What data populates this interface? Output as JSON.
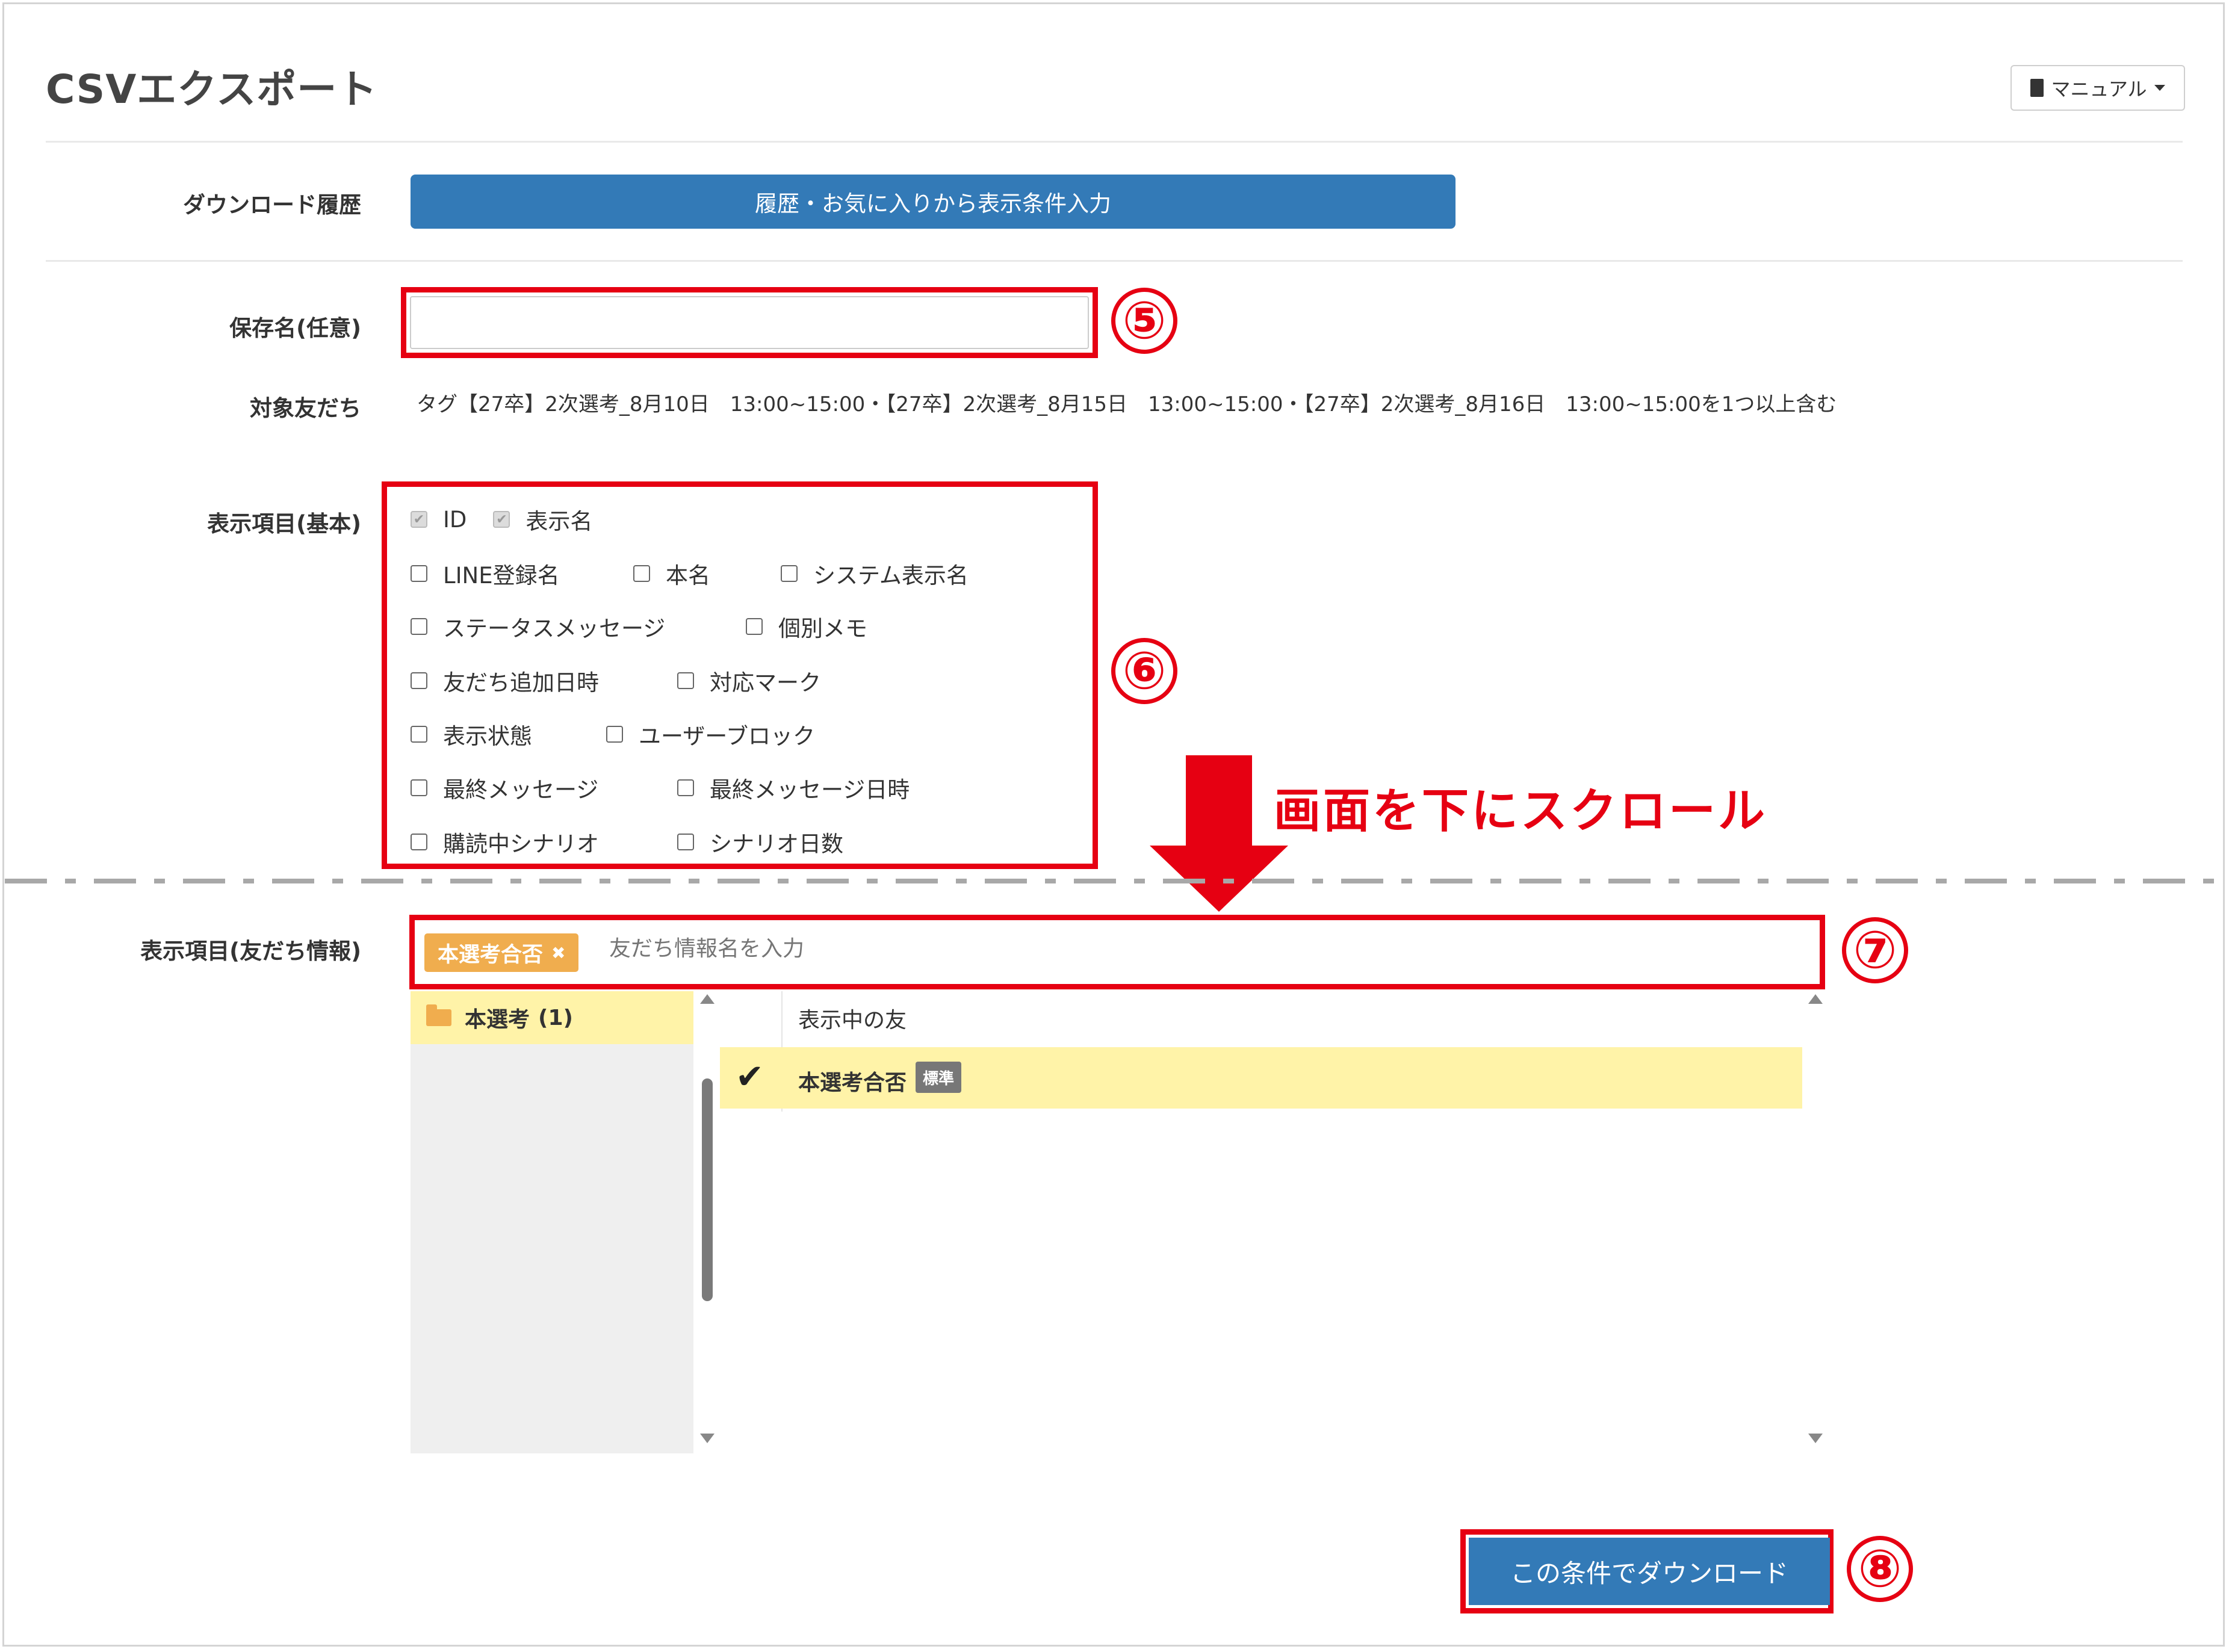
{
  "header": {
    "title": "CSVエクスポート",
    "manual_button": {
      "label": "マニュアル",
      "icon": "book-icon"
    }
  },
  "download_history": {
    "label": "ダウンロード履歴",
    "button_label": "履歴・お気に入りから表示条件入力"
  },
  "save_name": {
    "label": "保存名(任意)",
    "value": "",
    "placeholder": ""
  },
  "target_friends": {
    "label": "対象友だち",
    "text": "タグ【27卒】2次選考_8月10日　13:00~15:00・【27卒】2次選考_8月15日　13:00~15:00・【27卒】2次選考_8月16日　13:00~15:00を1つ以上含む"
  },
  "display_basic": {
    "label": "表示項目(基本)",
    "rows": [
      [
        {
          "label": "ID",
          "checked": true,
          "disabled": true
        },
        {
          "label": "表示名",
          "checked": true,
          "disabled": true
        }
      ],
      [
        {
          "label": "LINE登録名",
          "checked": false
        },
        {
          "label": "本名",
          "checked": false
        },
        {
          "label": "システム表示名",
          "checked": false
        }
      ],
      [
        {
          "label": "ステータスメッセージ",
          "checked": false
        },
        {
          "label": "個別メモ",
          "checked": false
        }
      ],
      [
        {
          "label": "友だち追加日時",
          "checked": false
        },
        {
          "label": "対応マーク",
          "checked": false
        }
      ],
      [
        {
          "label": "表示状態",
          "checked": false
        },
        {
          "label": "ユーザーブロック",
          "checked": false
        }
      ],
      [
        {
          "label": "最終メッセージ",
          "checked": false
        },
        {
          "label": "最終メッセージ日時",
          "checked": false
        }
      ],
      [
        {
          "label": "購読中シナリオ",
          "checked": false
        },
        {
          "label": "シナリオ日数",
          "checked": false
        }
      ]
    ]
  },
  "scroll_note": "画面を下にスクロール",
  "display_friend_info": {
    "label": "表示項目(友だち情報)",
    "selected_tag": "本選考合否",
    "tag_remove": "✖",
    "input_placeholder": "友だち情報名を入力",
    "folder": {
      "name": "本選考",
      "count": "(1)"
    },
    "list_header": "表示中の友",
    "items": [
      {
        "name": "本選考合否",
        "badge": "標準",
        "checked": true
      }
    ]
  },
  "download_button": {
    "label": "この条件でダウンロード"
  },
  "annotations": {
    "n5": "⑤",
    "n6": "⑥",
    "n7": "⑦",
    "n8": "⑧"
  },
  "colors": {
    "primary": "#337ab7",
    "warning": "#f0ad4e",
    "highlight": "#fff3a8",
    "annotation_red": "#e60012"
  }
}
